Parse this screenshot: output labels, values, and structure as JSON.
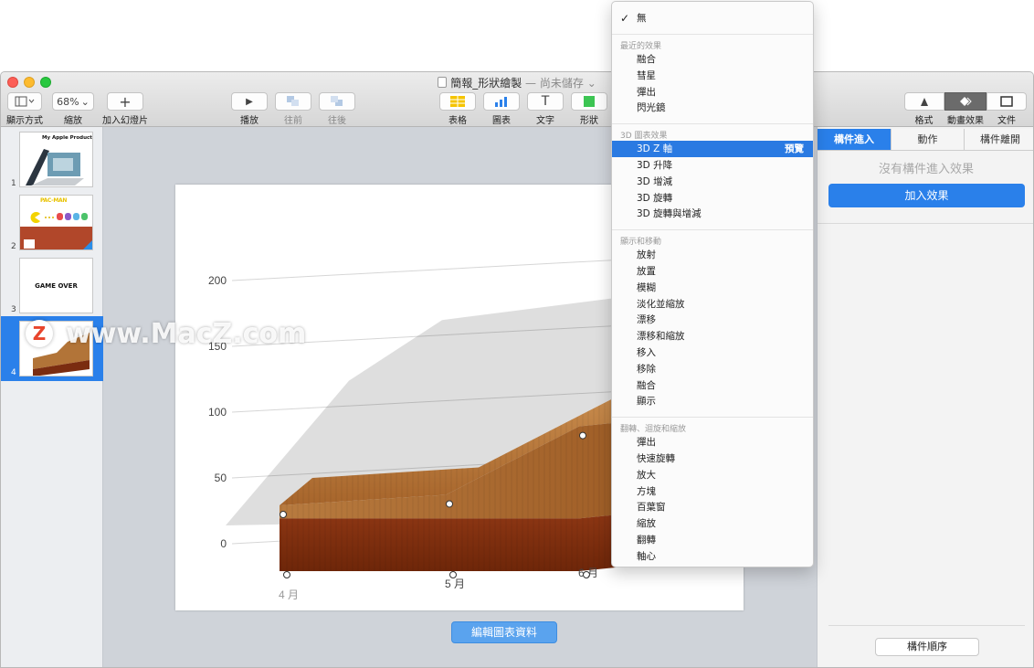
{
  "window": {
    "title": "簡報_形狀繪製",
    "title_sep": "—",
    "title_status": "尚未儲存",
    "colors": {
      "accent": "#2a80ea",
      "close": "#fc5f57",
      "minimize": "#fdbb2e",
      "zoom": "#29c840"
    }
  },
  "toolbar": {
    "view": {
      "label": "顯示方式",
      "icon": "sidebar-icon"
    },
    "zoom": {
      "label": "縮放",
      "value": "68%"
    },
    "add_slide": {
      "label": "加入幻燈片",
      "glyph": "+"
    },
    "play": {
      "label": "播放",
      "glyph": "▶"
    },
    "forward": {
      "label": "往前"
    },
    "backward": {
      "label": "往後"
    },
    "table": {
      "label": "表格"
    },
    "chart": {
      "label": "圖表"
    },
    "text": {
      "label": "文字",
      "glyph": "T"
    },
    "shape": {
      "label": "形狀"
    },
    "format": {
      "label": "格式"
    },
    "animate": {
      "label": "動畫效果"
    },
    "document": {
      "label": "文件"
    }
  },
  "slides": [
    {
      "number": "1",
      "title": "My Apple Product"
    },
    {
      "number": "2",
      "title": "PAC-MAN"
    },
    {
      "number": "3",
      "title": "GAME OVER"
    },
    {
      "number": "4",
      "title": ""
    }
  ],
  "watermark": {
    "text": "www.MacZ.com",
    "badge": "Z"
  },
  "chart": {
    "edit_button": "編輯圖表資料"
  },
  "chart_data": {
    "type": "area",
    "categories": [
      "4 月",
      "5 月",
      "6 月"
    ],
    "yticks": [
      "0",
      "50",
      "100",
      "150",
      "200"
    ],
    "ylim": [
      0,
      200
    ],
    "series": [
      {
        "values": [
          0,
          0,
          0
        ]
      },
      {
        "values": [
          50,
          58,
          110
        ]
      }
    ],
    "three_d": true,
    "texture": "wood"
  },
  "inspector": {
    "tabs": [
      "構件進入",
      "動作",
      "構件離開"
    ],
    "active_tab": 0,
    "empty_text": "沒有構件進入效果",
    "add_button": "加入效果",
    "order_button": "構件順序"
  },
  "menu": {
    "check": "✓",
    "none": "無",
    "sections": [
      {
        "header": "最近的效果",
        "items": [
          "融合",
          "彗星",
          "彈出",
          "閃光鏡"
        ]
      },
      {
        "header": "3D 圖表效果",
        "items": [
          "3D Z 軸",
          "3D 升降",
          "3D 增減",
          "3D 旋轉",
          "3D 旋轉與增減"
        ],
        "selected": "3D Z 軸",
        "preview": "預覽"
      },
      {
        "header": "顯示和移動",
        "items": [
          "放射",
          "放置",
          "模糊",
          "淡化並縮放",
          "漂移",
          "漂移和縮放",
          "移入",
          "移除",
          "融合",
          "顯示"
        ]
      },
      {
        "header": "翻轉、迴旋和縮放",
        "items": [
          "彈出",
          "快速旋轉",
          "放大",
          "方塊",
          "百葉窗",
          "縮放",
          "翻轉",
          "軸心"
        ]
      }
    ]
  }
}
